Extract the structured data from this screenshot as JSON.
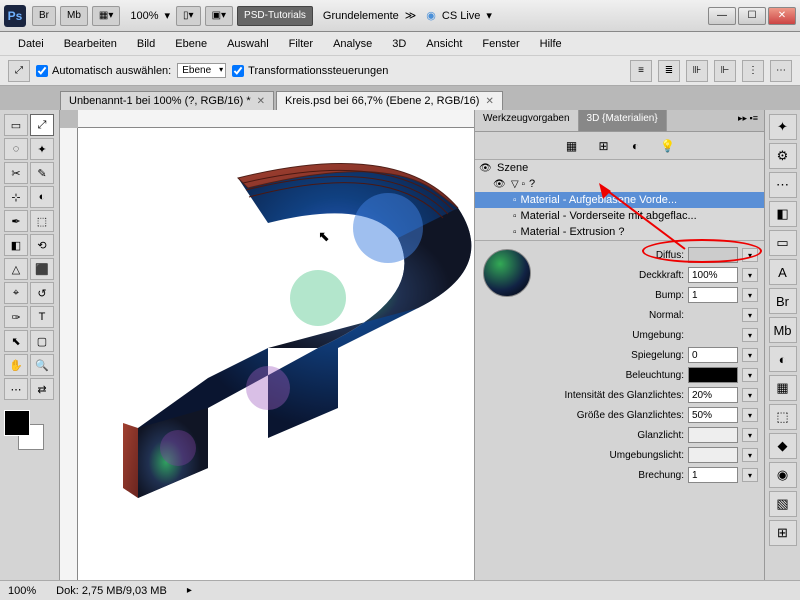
{
  "titlebar": {
    "app_abbrev": "Ps",
    "btns": [
      "Br",
      "Mb"
    ],
    "zoom": "100%",
    "workspace_left": "PSD-Tutorials",
    "workspace_right": "Grundelemente",
    "cs_live": "CS Live"
  },
  "menubar": [
    "Datei",
    "Bearbeiten",
    "Bild",
    "Ebene",
    "Auswahl",
    "Filter",
    "Analyse",
    "3D",
    "Ansicht",
    "Fenster",
    "Hilfe"
  ],
  "optbar": {
    "auto_select": "Automatisch auswählen:",
    "auto_select_value": "Ebene",
    "transform_controls": "Transformationssteuerungen"
  },
  "doc_tabs": [
    {
      "label": "Unbenannt-1 bei 100% (?, RGB/16) *",
      "active": false
    },
    {
      "label": "Kreis.psd bei 66,7% (Ebene 2, RGB/16)",
      "active": true
    }
  ],
  "tools": [
    "▭",
    "⤢",
    "◌",
    "✦",
    "✂",
    "✎",
    "⊹",
    "◐",
    "✒",
    "⬚",
    "◧",
    "⟲",
    "△",
    "⬛",
    "⌖",
    "↺",
    "✑",
    "T",
    "⬉",
    "▢",
    "✋",
    "🔍",
    "⋯",
    "⇄"
  ],
  "panel": {
    "tabs": {
      "left": "Werkzeugvorgaben",
      "right": "3D {Materialien}"
    },
    "scene": {
      "root": "Szene",
      "group": "?",
      "items": [
        "Material - Aufgeblasene Vorde...",
        "Material - Vorderseite mit abgeflac...",
        "Material - Extrusion ?"
      ]
    },
    "props": [
      {
        "label": "Diffus:",
        "type": "swatch",
        "value": ""
      },
      {
        "label": "Deckkraft:",
        "type": "input",
        "value": "100%"
      },
      {
        "label": "Bump:",
        "type": "input",
        "value": "1"
      },
      {
        "label": "Normal:",
        "type": "blank",
        "value": ""
      },
      {
        "label": "Umgebung:",
        "type": "blank",
        "value": ""
      },
      {
        "label": "Spiegelung:",
        "type": "input",
        "value": "0"
      },
      {
        "label": "Beleuchtung:",
        "type": "swatch-dark",
        "value": ""
      },
      {
        "label": "Intensität des Glanzlichtes:",
        "type": "input",
        "value": "20%"
      },
      {
        "label": "Größe des Glanzlichtes:",
        "type": "input",
        "value": "50%"
      },
      {
        "label": "Glanzlicht:",
        "type": "swatch-light",
        "value": ""
      },
      {
        "label": "Umgebungslicht:",
        "type": "swatch-light",
        "value": ""
      },
      {
        "label": "Brechung:",
        "type": "input",
        "value": "1"
      }
    ]
  },
  "statusbar": {
    "zoom": "100%",
    "doc": "Dok: 2,75 MB/9,03 MB"
  },
  "right_dock": [
    "✦",
    "⚙",
    "⋯",
    "◧",
    "▭",
    "A",
    "Br",
    "Mb",
    "◐",
    "▦",
    "⬚",
    "◆",
    "◉",
    "▧",
    "⊞"
  ]
}
